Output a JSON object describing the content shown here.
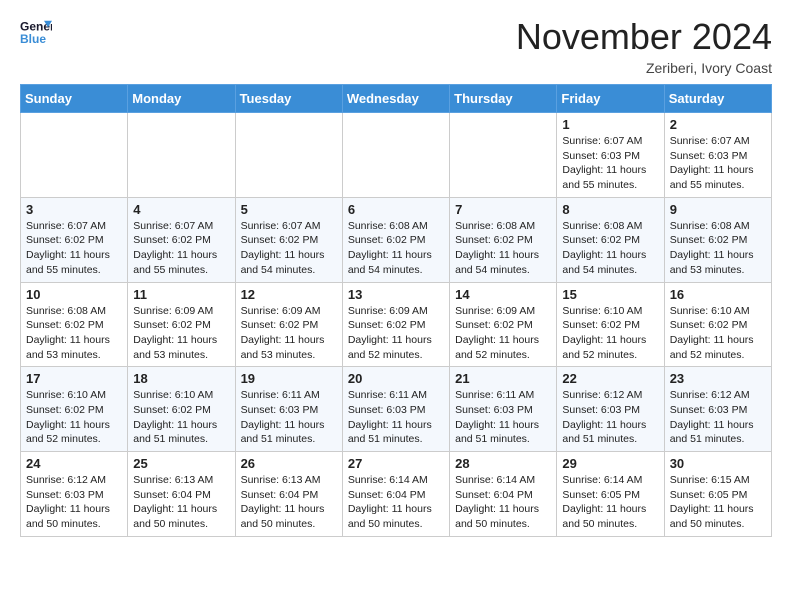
{
  "header": {
    "logo_line1": "General",
    "logo_line2": "Blue",
    "month_title": "November 2024",
    "location": "Zeriberi, Ivory Coast"
  },
  "weekdays": [
    "Sunday",
    "Monday",
    "Tuesday",
    "Wednesday",
    "Thursday",
    "Friday",
    "Saturday"
  ],
  "weeks": [
    [
      {
        "day": "",
        "info": ""
      },
      {
        "day": "",
        "info": ""
      },
      {
        "day": "",
        "info": ""
      },
      {
        "day": "",
        "info": ""
      },
      {
        "day": "",
        "info": ""
      },
      {
        "day": "1",
        "info": "Sunrise: 6:07 AM\nSunset: 6:03 PM\nDaylight: 11 hours\nand 55 minutes."
      },
      {
        "day": "2",
        "info": "Sunrise: 6:07 AM\nSunset: 6:03 PM\nDaylight: 11 hours\nand 55 minutes."
      }
    ],
    [
      {
        "day": "3",
        "info": "Sunrise: 6:07 AM\nSunset: 6:02 PM\nDaylight: 11 hours\nand 55 minutes."
      },
      {
        "day": "4",
        "info": "Sunrise: 6:07 AM\nSunset: 6:02 PM\nDaylight: 11 hours\nand 55 minutes."
      },
      {
        "day": "5",
        "info": "Sunrise: 6:07 AM\nSunset: 6:02 PM\nDaylight: 11 hours\nand 54 minutes."
      },
      {
        "day": "6",
        "info": "Sunrise: 6:08 AM\nSunset: 6:02 PM\nDaylight: 11 hours\nand 54 minutes."
      },
      {
        "day": "7",
        "info": "Sunrise: 6:08 AM\nSunset: 6:02 PM\nDaylight: 11 hours\nand 54 minutes."
      },
      {
        "day": "8",
        "info": "Sunrise: 6:08 AM\nSunset: 6:02 PM\nDaylight: 11 hours\nand 54 minutes."
      },
      {
        "day": "9",
        "info": "Sunrise: 6:08 AM\nSunset: 6:02 PM\nDaylight: 11 hours\nand 53 minutes."
      }
    ],
    [
      {
        "day": "10",
        "info": "Sunrise: 6:08 AM\nSunset: 6:02 PM\nDaylight: 11 hours\nand 53 minutes."
      },
      {
        "day": "11",
        "info": "Sunrise: 6:09 AM\nSunset: 6:02 PM\nDaylight: 11 hours\nand 53 minutes."
      },
      {
        "day": "12",
        "info": "Sunrise: 6:09 AM\nSunset: 6:02 PM\nDaylight: 11 hours\nand 53 minutes."
      },
      {
        "day": "13",
        "info": "Sunrise: 6:09 AM\nSunset: 6:02 PM\nDaylight: 11 hours\nand 52 minutes."
      },
      {
        "day": "14",
        "info": "Sunrise: 6:09 AM\nSunset: 6:02 PM\nDaylight: 11 hours\nand 52 minutes."
      },
      {
        "day": "15",
        "info": "Sunrise: 6:10 AM\nSunset: 6:02 PM\nDaylight: 11 hours\nand 52 minutes."
      },
      {
        "day": "16",
        "info": "Sunrise: 6:10 AM\nSunset: 6:02 PM\nDaylight: 11 hours\nand 52 minutes."
      }
    ],
    [
      {
        "day": "17",
        "info": "Sunrise: 6:10 AM\nSunset: 6:02 PM\nDaylight: 11 hours\nand 52 minutes."
      },
      {
        "day": "18",
        "info": "Sunrise: 6:10 AM\nSunset: 6:02 PM\nDaylight: 11 hours\nand 51 minutes."
      },
      {
        "day": "19",
        "info": "Sunrise: 6:11 AM\nSunset: 6:03 PM\nDaylight: 11 hours\nand 51 minutes."
      },
      {
        "day": "20",
        "info": "Sunrise: 6:11 AM\nSunset: 6:03 PM\nDaylight: 11 hours\nand 51 minutes."
      },
      {
        "day": "21",
        "info": "Sunrise: 6:11 AM\nSunset: 6:03 PM\nDaylight: 11 hours\nand 51 minutes."
      },
      {
        "day": "22",
        "info": "Sunrise: 6:12 AM\nSunset: 6:03 PM\nDaylight: 11 hours\nand 51 minutes."
      },
      {
        "day": "23",
        "info": "Sunrise: 6:12 AM\nSunset: 6:03 PM\nDaylight: 11 hours\nand 51 minutes."
      }
    ],
    [
      {
        "day": "24",
        "info": "Sunrise: 6:12 AM\nSunset: 6:03 PM\nDaylight: 11 hours\nand 50 minutes."
      },
      {
        "day": "25",
        "info": "Sunrise: 6:13 AM\nSunset: 6:04 PM\nDaylight: 11 hours\nand 50 minutes."
      },
      {
        "day": "26",
        "info": "Sunrise: 6:13 AM\nSunset: 6:04 PM\nDaylight: 11 hours\nand 50 minutes."
      },
      {
        "day": "27",
        "info": "Sunrise: 6:14 AM\nSunset: 6:04 PM\nDaylight: 11 hours\nand 50 minutes."
      },
      {
        "day": "28",
        "info": "Sunrise: 6:14 AM\nSunset: 6:04 PM\nDaylight: 11 hours\nand 50 minutes."
      },
      {
        "day": "29",
        "info": "Sunrise: 6:14 AM\nSunset: 6:05 PM\nDaylight: 11 hours\nand 50 minutes."
      },
      {
        "day": "30",
        "info": "Sunrise: 6:15 AM\nSunset: 6:05 PM\nDaylight: 11 hours\nand 50 minutes."
      }
    ]
  ]
}
